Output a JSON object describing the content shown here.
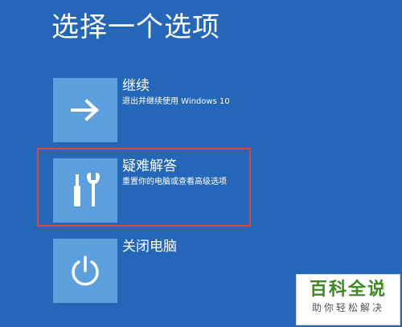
{
  "page": {
    "title": "选择一个选项"
  },
  "options": [
    {
      "title": "继续",
      "description": "退出并继续使用 Windows 10",
      "icon": "arrow-right-icon"
    },
    {
      "title": "疑难解答",
      "description": "重置你的电脑或查看高级选项",
      "icon": "tools-icon"
    },
    {
      "title": "关闭电脑",
      "description": "",
      "icon": "power-icon"
    }
  ],
  "watermark": {
    "main": "百科全说",
    "sub": "助你轻松解决"
  },
  "colors": {
    "background": "#2467b8",
    "tile": "#5b9fdc",
    "highlight": "#e0443a",
    "watermark_green": "#3a8a1e"
  }
}
